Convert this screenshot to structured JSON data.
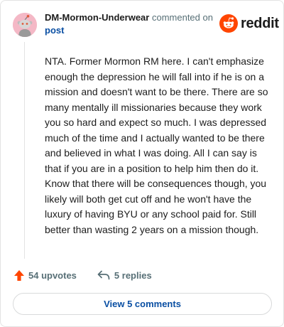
{
  "header": {
    "username": "DM-Mormon-Underwear",
    "commented_text": "commented on",
    "post_link": "post"
  },
  "brand": {
    "wordmark": "reddit",
    "icon": "reddit-snoo-icon",
    "color": "#ff4500"
  },
  "avatar": {
    "icon": "snoo-avatar-icon",
    "bg_color": "#f4b8c6"
  },
  "comment": {
    "body": "NTA. Former Mormon RM here. I can't emphasize enough the depression he will fall into if he is on a mission and doesn't want to be there. There are so many mentally ill missionaries because they work you so hard and expect so much. I was depressed much of the time and I actually wanted to be there and believed in what I was doing. All I can say is that if you are in a position to help him then do it. Know that there will be consequences though, you likely will both get cut off and he won't have the luxury of having BYU or any school paid for. Still better than wasting 2 years on a mission though."
  },
  "actions": {
    "upvotes": "54 upvotes",
    "upvote_icon": "upvote-arrow-icon",
    "upvote_color": "#ff4500",
    "replies": "5 replies",
    "reply_icon": "reply-arrow-icon"
  },
  "footer": {
    "view_comments": "View 5 comments"
  },
  "colors": {
    "link": "#0a4fa3",
    "meta": "#576f76",
    "border": "#e3e3e3"
  }
}
